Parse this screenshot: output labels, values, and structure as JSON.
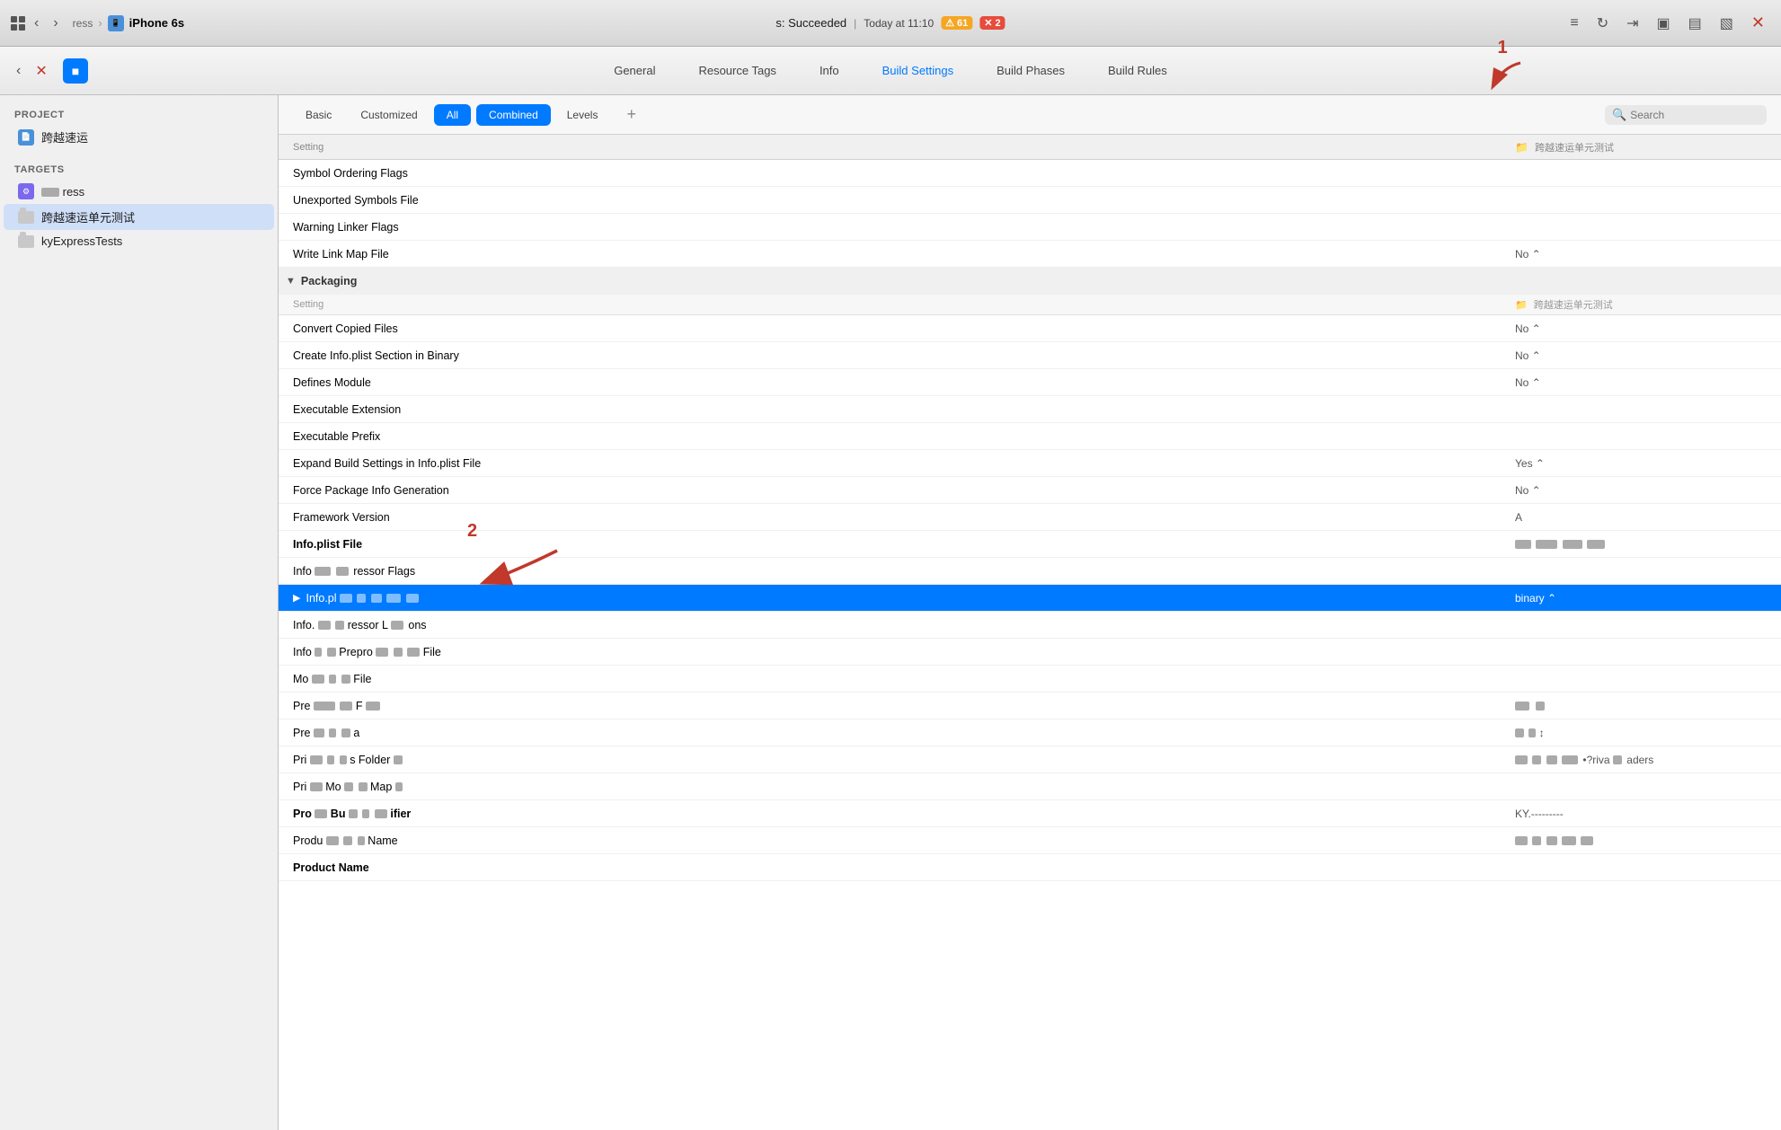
{
  "titlebar": {
    "breadcrumb": "ress",
    "device": "iPhone 6s",
    "status": "s: Succeeded",
    "time": "Today at 11:10",
    "warning_count": "61",
    "error_count": "2"
  },
  "tabs": {
    "items": [
      {
        "id": "general",
        "label": "General"
      },
      {
        "id": "resource-tags",
        "label": "Resource Tags"
      },
      {
        "id": "info",
        "label": "Info"
      },
      {
        "id": "build-settings",
        "label": "Build Settings"
      },
      {
        "id": "build-phases",
        "label": "Build Phases"
      },
      {
        "id": "build-rules",
        "label": "Build Rules"
      }
    ],
    "active": "build-settings"
  },
  "subtabs": {
    "basic": "Basic",
    "customized": "Customized",
    "all": "All",
    "combined": "Combined",
    "levels": "Levels",
    "search_placeholder": "Search"
  },
  "sidebar": {
    "project_label": "PROJECT",
    "project_name": "跨越速运",
    "targets_label": "TARGETS",
    "target_items": [
      {
        "id": "target-ress",
        "label": "ress",
        "selected": false
      },
      {
        "id": "target-unit-test",
        "label": "跨越速运单元测试",
        "selected": true
      },
      {
        "id": "target-express",
        "label": "kyExpressTests",
        "selected": false
      }
    ]
  },
  "col_headers": {
    "setting": "Setting",
    "target": "跨越速运单元测试"
  },
  "settings": {
    "pre_section_rows": [
      {
        "id": "symbol-ordering",
        "name": "Symbol Ordering Flags",
        "value": ""
      },
      {
        "id": "unexported-symbols",
        "name": "Unexported Symbols File",
        "value": ""
      },
      {
        "id": "warning-linker",
        "name": "Warning Linker Flags",
        "value": ""
      },
      {
        "id": "write-link-map",
        "name": "Write Link Map File",
        "value": "No ⌃"
      }
    ],
    "packaging_section": "Packaging",
    "packaging_rows": [
      {
        "id": "convert-copied",
        "name": "Convert Copied Files",
        "value": "No ⌃",
        "bold": false
      },
      {
        "id": "create-info-plist",
        "name": "Create Info.plist Section in Binary",
        "value": "No ⌃",
        "bold": false
      },
      {
        "id": "defines-module",
        "name": "Defines Module",
        "value": "No ⌃",
        "bold": false
      },
      {
        "id": "exec-extension",
        "name": "Executable Extension",
        "value": "",
        "bold": false
      },
      {
        "id": "exec-prefix",
        "name": "Executable Prefix",
        "value": "",
        "bold": false
      },
      {
        "id": "expand-build",
        "name": "Expand Build Settings in Info.plist File",
        "value": "Yes ⌃",
        "bold": false
      },
      {
        "id": "force-package",
        "name": "Force Package Info Generation",
        "value": "No ⌃",
        "bold": false
      },
      {
        "id": "framework-version",
        "name": "Framework Version",
        "value": "A",
        "bold": false
      },
      {
        "id": "info-plist-file",
        "name": "Info.plist File",
        "value": "██ ██ ██ ██",
        "bold": true
      },
      {
        "id": "info-preprocessor-flags",
        "name": "Info██ ██  ██ ██ressor Flags",
        "value": "",
        "bold": false
      }
    ],
    "selected_row": {
      "id": "info-plist-expanded",
      "name": "Info.pl██ ██ ██ ██ ██",
      "value": "binary ⌃",
      "selected": true
    },
    "post_selected_rows": [
      {
        "id": "info-preprocessor-l",
        "name": "Info.██ ██ ██ressor L██  ons",
        "value": ""
      },
      {
        "id": "info-preprocessor-f2",
        "name": "Info██ ██ Prepro██ ██ ██ ██ File",
        "value": ""
      },
      {
        "id": "module-file",
        "name": "Mo██ ██ ██ File",
        "value": ""
      },
      {
        "id": "pre-something",
        "name": "Pre ██ ██ ██ ██ F██",
        "value": "██ ██"
      },
      {
        "id": "pre-something2",
        "name": "Pre██ ██ ██ ██a",
        "value": "██ ██ ↕"
      },
      {
        "id": "private-folder",
        "name": "Pri██ ██ ██ s Folder██",
        "value": "██ ██ ██ ██ ██ •?riva██ ██aders"
      },
      {
        "id": "private-module-map",
        "name": "Pri██ Mo██ ██ Map██",
        "value": ""
      },
      {
        "id": "product-bundle-identifier",
        "name": "Pro██ Bu██ ██ ██ifier",
        "value": "KY.---------",
        "bold": true
      },
      {
        "id": "product-bundle-name",
        "name": "Produ██ ██ ██ Name",
        "value": "██ ██ ██ ██ ██"
      },
      {
        "id": "product-name",
        "name": "Product Name",
        "value": "",
        "bold": true
      }
    ]
  },
  "annotations": {
    "label_1": "1",
    "label_2": "2"
  }
}
